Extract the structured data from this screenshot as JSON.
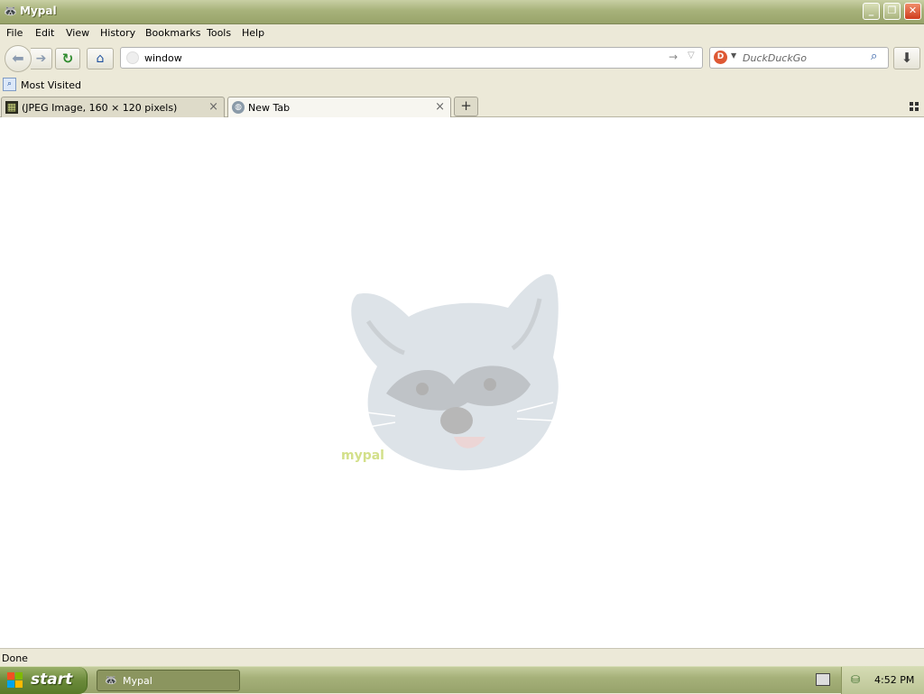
{
  "window": {
    "title": "Mypal",
    "app_icon": "raccoon-icon"
  },
  "window_controls": {
    "minimize": "minimize-icon",
    "restore": "restore-icon",
    "close": "close-icon"
  },
  "menu": [
    {
      "label": "File"
    },
    {
      "label": "Edit"
    },
    {
      "label": "View"
    },
    {
      "label": "History"
    },
    {
      "label": "Bookmarks"
    },
    {
      "label": "Tools"
    },
    {
      "label": "Help"
    }
  ],
  "navbar": {
    "url_value": "window",
    "search_placeholder": "DuckDuckGo",
    "search_engine_icon": "duckduckgo-icon"
  },
  "bookmarks": {
    "items": [
      {
        "label": "Most Visited"
      }
    ]
  },
  "tabs": [
    {
      "label": "(JPEG Image, 160 × 120 pixels)",
      "active": false,
      "icon": "image-thumbnail-icon"
    },
    {
      "label": "New Tab",
      "active": true,
      "icon": "globe-icon"
    }
  ],
  "content": {
    "watermark_text": "mypal"
  },
  "status": {
    "text": "Done"
  },
  "taskbar": {
    "start_label": "start",
    "task_label": "Mypal",
    "clock": "4:52 PM"
  },
  "colors": {
    "titlebar": "#a7b27a",
    "taskbar": "#a6b17a",
    "start_button": "#6b8a3a",
    "close_button": "#cf3d1d"
  }
}
